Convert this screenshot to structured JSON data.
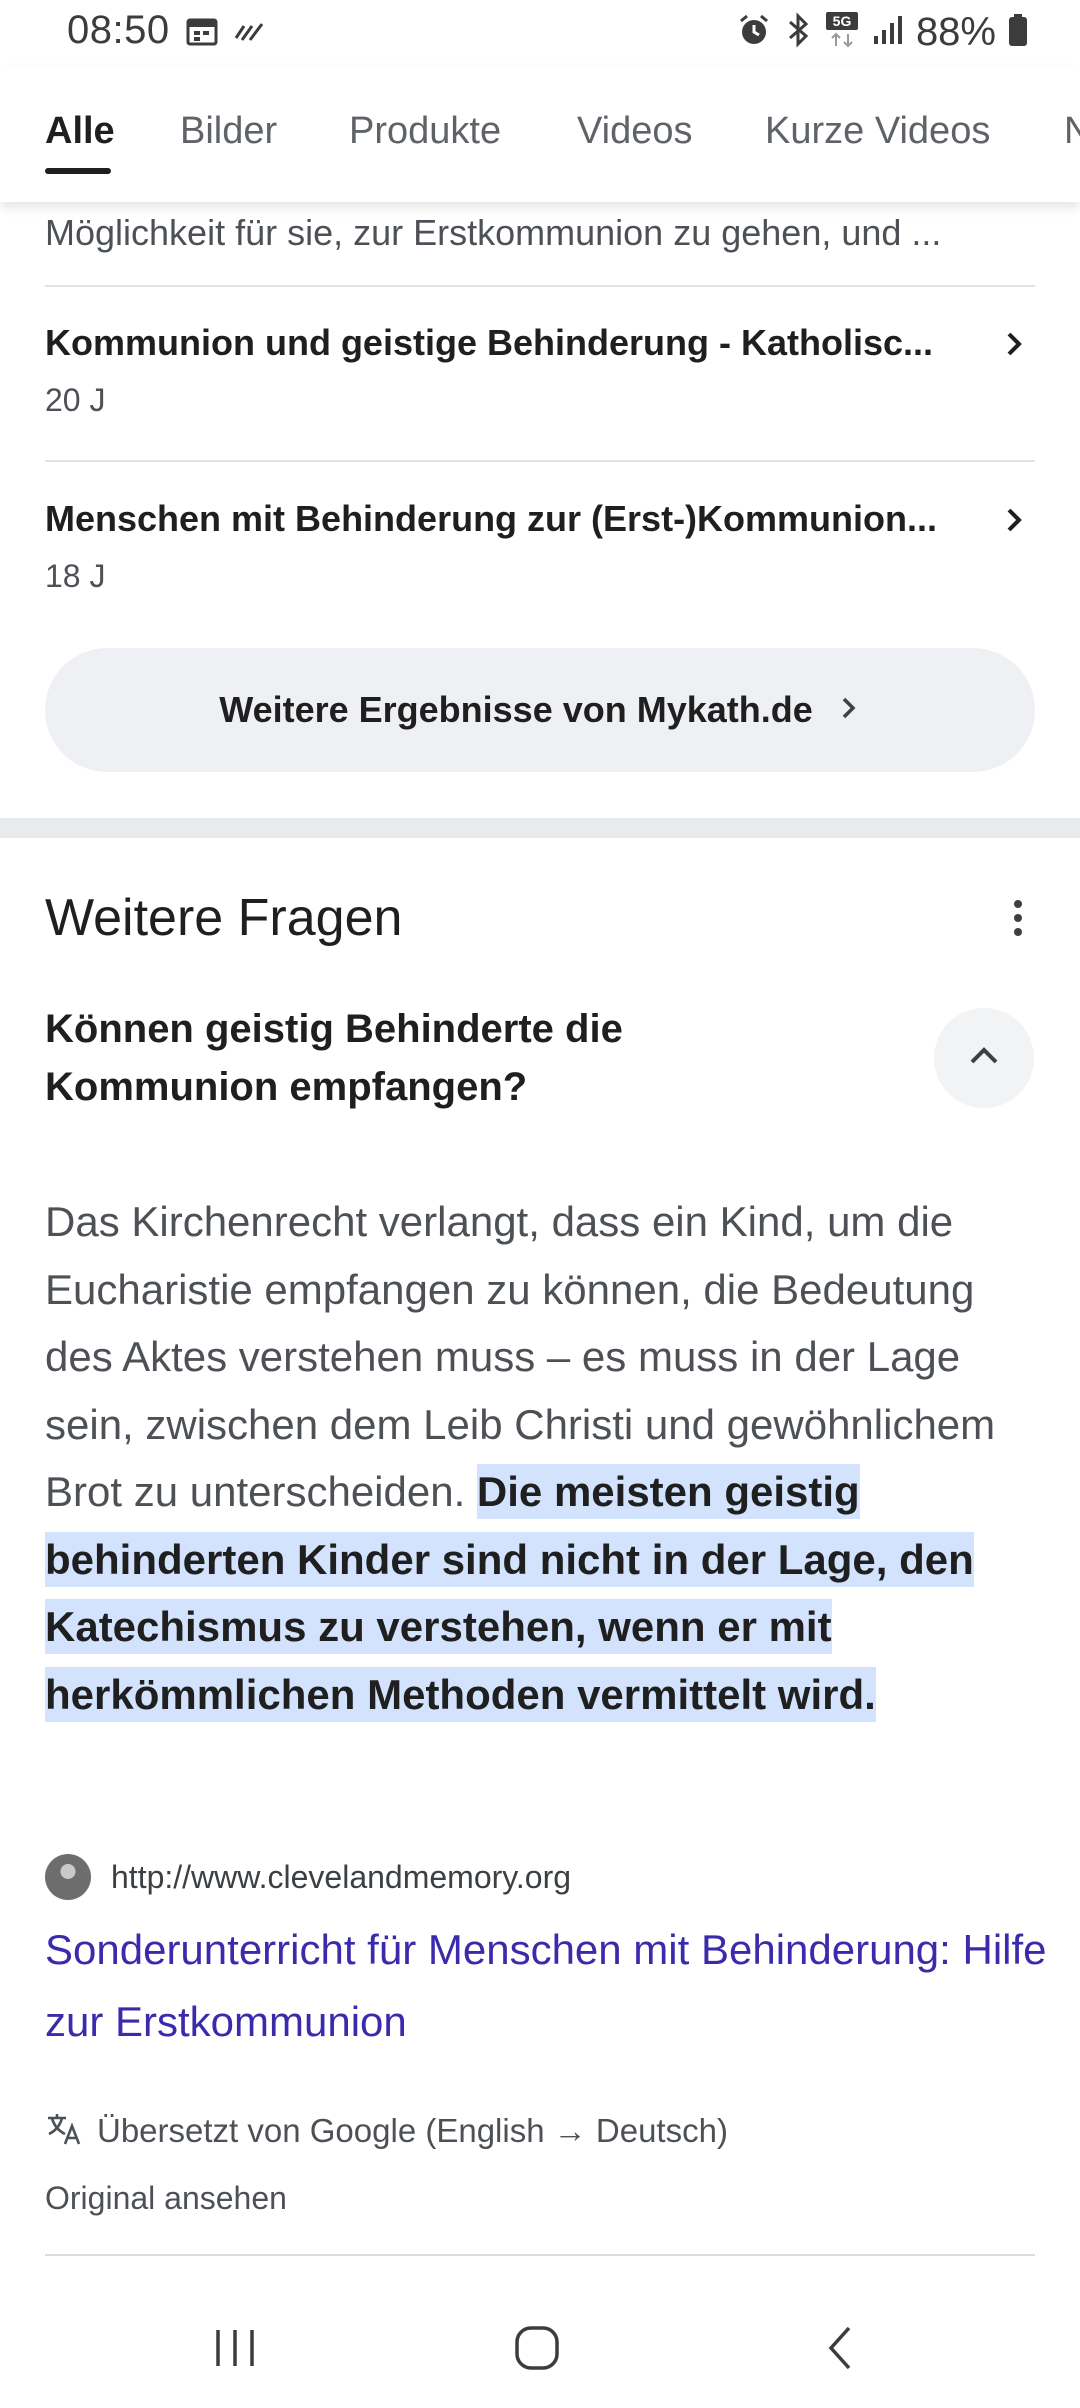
{
  "status_bar": {
    "time": "08:50",
    "battery": "88%",
    "network": "5G"
  },
  "tabs": [
    {
      "label": "Alle",
      "active": true
    },
    {
      "label": "Bilder",
      "active": false
    },
    {
      "label": "Produkte",
      "active": false
    },
    {
      "label": "Videos",
      "active": false
    },
    {
      "label": "Kurze Videos",
      "active": false
    },
    {
      "label": "N",
      "active": false
    }
  ],
  "site_results": {
    "snippet_tail": "Möglichkeit für sie, zur Erstkommunion zu gehen, und ...",
    "items": [
      {
        "title": "Kommunion und geistige Behinderung - Katholisc...",
        "age": "20 J"
      },
      {
        "title": "Menschen mit Behinderung zur (Erst-)Kommunion...",
        "age": "18 J"
      }
    ],
    "more_button": "Weitere Ergebnisse von Mykath.de"
  },
  "paa": {
    "heading": "Weitere Fragen",
    "question": "Können geistig Behinderte die Kommunion empfangen?",
    "answer_plain": "Das Kirchenrecht verlangt, dass ein Kind, um die Eucharistie empfangen zu können, die Bedeutung des Aktes verstehen muss – es muss in der Lage sein, zwischen dem Leib Christi und gewöhnlichem Brot zu unterscheiden. ",
    "answer_highlight": "Die meisten geistig behinderten Kinder sind nicht in der Lage, den Katechismus zu verstehen, wenn er mit herkömmlichen Methoden vermittelt wird.",
    "source_url": "http://www.clevelandmemory.org",
    "result_title": "Sonderunterricht für Menschen mit Behinderung: Hilfe zur Erstkommunion",
    "translated_note": "Übersetzt von Google (English → Deutsch)",
    "original_link": "Original ansehen"
  },
  "colors": {
    "highlight": "#d3e3fd",
    "link": "#3b2bac",
    "pill_bg": "#eef0f3"
  }
}
